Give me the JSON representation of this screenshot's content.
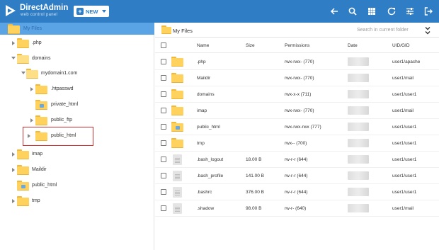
{
  "app": {
    "title": "DirectAdmin",
    "subtitle": "web control panel",
    "new_button": "NEW"
  },
  "toolbar": {
    "icons": [
      "back-arrow-icon",
      "search-icon",
      "grid-view-icon",
      "refresh-icon",
      "settings-sliders-icon",
      "logout-icon"
    ]
  },
  "tree": {
    "root_label": "My Files",
    "items": [
      {
        "label": ".php",
        "expanded": false
      },
      {
        "label": "domains",
        "expanded": true
      },
      {
        "label": "mydomain1.com",
        "expanded": true
      },
      {
        "label": ".htpasswd",
        "expanded": false
      },
      {
        "label": "private_html",
        "expanded": false
      },
      {
        "label": "public_ftp",
        "expanded": false
      },
      {
        "label": "public_html",
        "expanded": false,
        "highlighted": true
      },
      {
        "label": "imap",
        "expanded": false
      },
      {
        "label": "Maildir",
        "expanded": false
      },
      {
        "label": "public_html",
        "expanded": false
      },
      {
        "label": "tmp",
        "expanded": false
      }
    ]
  },
  "content": {
    "title": "My Files",
    "search_placeholder": "Search in current folder",
    "columns": {
      "name": "Name",
      "size": "Size",
      "permissions": "Permissions",
      "date": "Date",
      "uid": "UID/GID"
    },
    "rows": [
      {
        "type": "folder",
        "name": ".php",
        "size": "",
        "permissions": "rwx-rwx- (770)",
        "uid": "user1/apache"
      },
      {
        "type": "folder",
        "name": "Maildir",
        "size": "",
        "permissions": "rwx-rwx- (770)",
        "uid": "user1/mail"
      },
      {
        "type": "folder",
        "name": "domains",
        "size": "",
        "permissions": "rwx-x-x (711)",
        "uid": "user1/user1"
      },
      {
        "type": "folder",
        "name": "imap",
        "size": "",
        "permissions": "rwx-rwx- (770)",
        "uid": "user1/mail"
      },
      {
        "type": "folder-link",
        "name": "public_html",
        "size": "",
        "permissions": "rwx-rwx-rwx (777)",
        "uid": "user1/user1"
      },
      {
        "type": "folder",
        "name": "tmp",
        "size": "",
        "permissions": "rwx-- (700)",
        "uid": "user1/user1"
      },
      {
        "type": "file",
        "name": ".bash_logout",
        "size": "18.00 B",
        "permissions": "rw-r-r (644)",
        "uid": "user1/user1"
      },
      {
        "type": "file",
        "name": ".bash_profile",
        "size": "141.00 B",
        "permissions": "rw-r-r (644)",
        "uid": "user1/user1"
      },
      {
        "type": "file",
        "name": ".bashrc",
        "size": "376.00 B",
        "permissions": "rw-r-r (644)",
        "uid": "user1/user1"
      },
      {
        "type": "file",
        "name": ".shadow",
        "size": "98.00 B",
        "permissions": "rw-r- (640)",
        "uid": "user1/mail"
      }
    ]
  },
  "colors": {
    "topbar": "#2e7dc5",
    "root_selected": "#5aa3e4",
    "folder": "#ffd25e",
    "highlight": "#d32f2f"
  }
}
